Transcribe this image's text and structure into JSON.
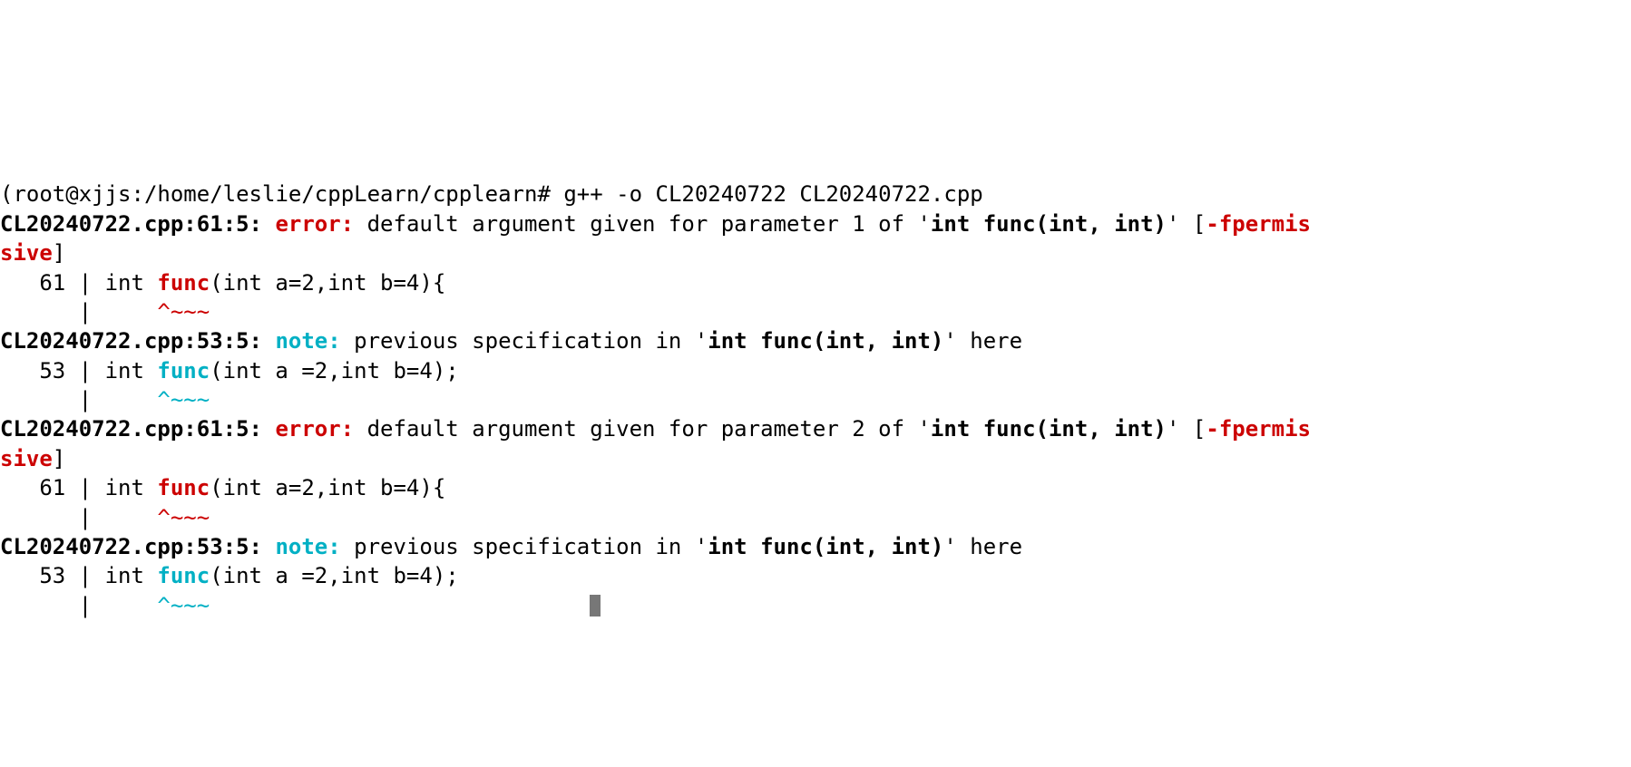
{
  "prompt": {
    "left_cut": "(",
    "user_host": "root@xjjs",
    "sep": ":",
    "cwd": "/home/leslie/cppLearn/cpplearn",
    "hash": "# ",
    "command": "g++ -o CL20240722 CL20240722.cpp"
  },
  "err1": {
    "loc": "CL20240722.cpp:61:5: ",
    "tag": "error: ",
    "msg_a": "default argument given for parameter 1 of '",
    "sig": "int func(int, int)",
    "msg_b": "' [",
    "flag": "-fpermis",
    "wrap": "sive",
    "close": "]"
  },
  "ctx61": {
    "gutter": "   61 | ",
    "pre": "int ",
    "id": "func",
    "post": "(int a=2,int b=4){",
    "caret_gutter": "      | ",
    "caret_pad": "    ",
    "caret": "^~~~"
  },
  "note1": {
    "loc": "CL20240722.cpp:53:5: ",
    "tag": "note: ",
    "msg_a": "previous specification in '",
    "sig": "int func(int, int)",
    "msg_b": "' here"
  },
  "ctx53": {
    "gutter": "   53 | ",
    "pre": "int ",
    "id": "func",
    "post": "(int a =2,int b=4);",
    "caret_gutter": "      | ",
    "caret_pad": "    ",
    "caret": "^~~~"
  },
  "err2": {
    "loc": "CL20240722.cpp:61:5: ",
    "tag": "error: ",
    "msg_a": "default argument given for parameter 2 of '",
    "sig": "int func(int, int)",
    "msg_b": "' [",
    "flag": "-fpermis",
    "wrap": "sive",
    "close": "]"
  },
  "note2": {
    "loc": "CL20240722.cpp:53:5: ",
    "tag": "note: ",
    "msg_a": "previous specification in '",
    "sig": "int func(int, int)",
    "msg_b": "' here"
  }
}
